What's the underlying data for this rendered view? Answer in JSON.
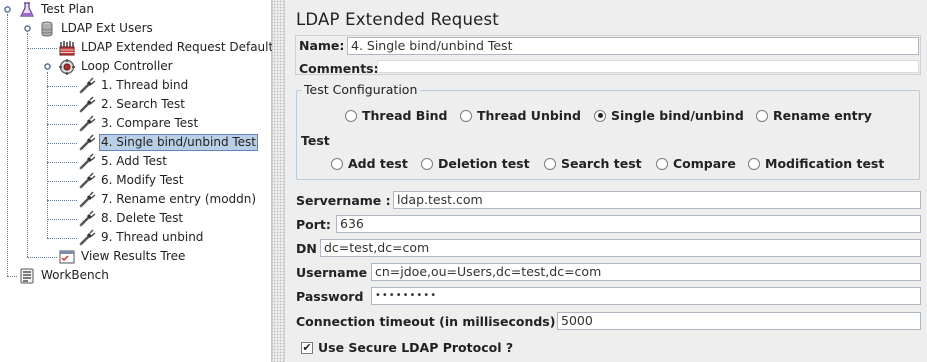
{
  "tree": {
    "items": [
      {
        "label": "Test Plan",
        "icon": "test-plan-icon"
      },
      {
        "label": "LDAP Ext Users",
        "icon": "thread-group-icon"
      },
      {
        "label": "LDAP Extended Request Defaults",
        "icon": "config-defaults-icon"
      },
      {
        "label": "Loop Controller",
        "icon": "loop-controller-icon"
      },
      {
        "label": "1. Thread bind",
        "icon": "sampler-pipette-icon"
      },
      {
        "label": "2. Search Test",
        "icon": "sampler-pipette-icon"
      },
      {
        "label": "3. Compare Test",
        "icon": "sampler-pipette-icon"
      },
      {
        "label": "4. Single bind/unbind Test",
        "icon": "sampler-pipette-icon",
        "selected": true
      },
      {
        "label": "5. Add Test",
        "icon": "sampler-pipette-icon"
      },
      {
        "label": "6. Modify Test",
        "icon": "sampler-pipette-icon"
      },
      {
        "label": "7. Rename entry (moddn)",
        "icon": "sampler-pipette-icon"
      },
      {
        "label": "8. Delete Test",
        "icon": "sampler-pipette-icon"
      },
      {
        "label": "9. Thread unbind",
        "icon": "sampler-pipette-icon"
      },
      {
        "label": "View Results Tree",
        "icon": "results-tree-icon"
      },
      {
        "label": "WorkBench",
        "icon": "workbench-icon"
      }
    ]
  },
  "panel": {
    "title": "LDAP Extended Request",
    "name_label": "Name:",
    "name_value": "4. Single bind/unbind Test",
    "comments_label": "Comments:",
    "comments_value": "",
    "test_config": {
      "legend": "Test Configuration",
      "options": [
        {
          "label": "Thread Bind",
          "selected": false
        },
        {
          "label": "Thread Unbind",
          "selected": false
        },
        {
          "label": "Single bind/unbind",
          "selected": true
        },
        {
          "label": "Rename entry",
          "selected": false
        }
      ],
      "test_label": "Test",
      "test_options": [
        {
          "label": "Add test",
          "selected": false
        },
        {
          "label": "Deletion test",
          "selected": false
        },
        {
          "label": "Search test",
          "selected": false
        },
        {
          "label": "Compare",
          "selected": false
        },
        {
          "label": "Modification test",
          "selected": false
        }
      ]
    },
    "fields": {
      "servername_label": "Servername :",
      "servername_value": "ldap.test.com",
      "port_label": "Port:",
      "port_value": "636",
      "dn_label": "DN",
      "dn_value": "dc=test,dc=com",
      "username_label": "Username",
      "username_value": "cn=jdoe,ou=Users,dc=test,dc=com",
      "password_label": "Password",
      "password_value": "•••••••••",
      "timeout_label": "Connection timeout (in milliseconds)",
      "timeout_value": "5000",
      "secure_label": "Use Secure LDAP Protocol ?",
      "secure_checked": true,
      "secure_mark": "✔"
    }
  }
}
